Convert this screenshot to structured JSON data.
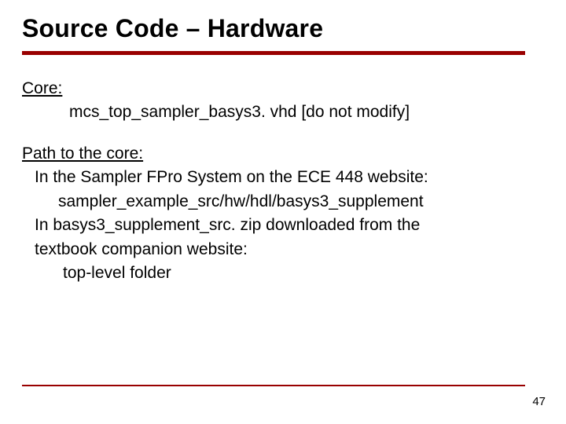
{
  "title": "Source Code – Hardware",
  "core_label": "Core:",
  "core_file": "mcs_top_sampler_basys3. vhd [do not modify]",
  "path_label": "Path to the core:",
  "path_line1": "In the Sampler FPro System on the ECE 448 website:",
  "path_line1_value": "sampler_example_src/hw/hdl/basys3_supplement",
  "path_line2a": "In basys3_supplement_src. zip downloaded from the",
  "path_line2b": "textbook companion website:",
  "path_line2_value": "top-level folder",
  "page_number": "47"
}
